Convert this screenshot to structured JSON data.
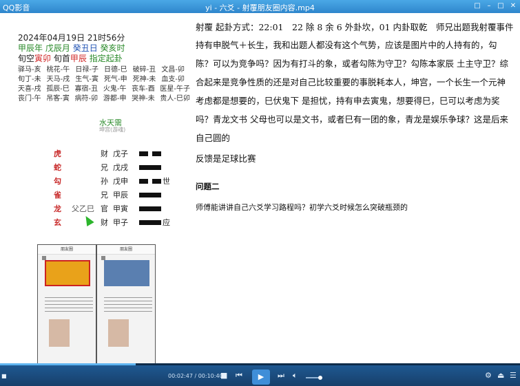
{
  "window": {
    "app_name": "QQ影音",
    "file_title": "yi - 六爻 - 射覆朋友圈内容.mp4",
    "buttons": [
      "□",
      "–",
      "□",
      "✕"
    ]
  },
  "chart": {
    "date_line": "2024年04月19日 21时56分",
    "ganzhi": {
      "y": "甲辰年",
      "m": "戊辰月",
      "d": "癸丑日",
      "h": "癸亥时"
    },
    "xunkong": {
      "label1": "旬空",
      "v1": "寅卯",
      "label2": "旬首",
      "v2": "甲辰",
      "label3": "指定起卦"
    },
    "shensha_rows": [
      [
        "驿马-亥",
        "桃花-午",
        "日禄-子",
        "日德-巳",
        "破碎-丑",
        "文昌-卯"
      ],
      [
        "旬丁-未",
        "天马-戌",
        "生气-寅",
        "死气-申",
        "死神-未",
        "血支-卯"
      ],
      [
        "天喜-戌",
        "孤辰-巳",
        "寡宿-丑",
        "火鬼-午",
        "丧车-酉",
        "医星-午子"
      ],
      [
        "丧门-午",
        "吊客-寅",
        "病符-卯",
        "游都-申",
        "哭神-未",
        "贵人-巳卯"
      ]
    ],
    "gua_name": "水天需",
    "gua_sub": "坤宫(游魂)",
    "lines": [
      {
        "beast": "虎",
        "fushen": "",
        "liuqin": "财",
        "ganzhi": "戊子",
        "type": "yin",
        "shiying": ""
      },
      {
        "beast": "蛇",
        "fushen": "",
        "liuqin": "兄",
        "ganzhi": "戊戌",
        "type": "yang",
        "shiying": ""
      },
      {
        "beast": "勾",
        "fushen": "",
        "liuqin": "孙",
        "ganzhi": "戊申",
        "type": "yin",
        "shiying": "世"
      },
      {
        "beast": "雀",
        "fushen": "",
        "liuqin": "兄",
        "ganzhi": "甲辰",
        "type": "yang",
        "shiying": ""
      },
      {
        "beast": "龙",
        "fushen": "父乙巳",
        "liuqin": "官",
        "ganzhi": "甲寅",
        "type": "yang",
        "shiying": ""
      },
      {
        "beast": "玄",
        "fushen": "",
        "liuqin": "财",
        "ganzhi": "甲子",
        "type": "yang",
        "shiying": "应"
      }
    ]
  },
  "phones": [
    {
      "title": "朋友圈"
    },
    {
      "title": "朋友圈"
    }
  ],
  "text": {
    "head": "射覆 起卦方式：22:01　22 除 8 余 6 外卦坎，01 内卦取乾　师兄出题我射覆事件",
    "body": "持有申脱气＋长生，我和出题人都没有这个气势，应该是图片中的人持有的，勾陈？可以为竞争吗？因为有打斗的象，或者勾陈为守卫？勾陈本家辰 土主守卫？综合起来是竞争性质的还是对自己比较重要的事脱耗本人，坤宫，一个长生一个元神考虑都是想要的，巳伏鬼下 是担忧，持有申去寅鬼，想要得巳，巳可以考虑为奖吗？青龙文书 父母也可以是文书，或者巳有一团的象，青龙是娱乐争球？这是后来自己圆的",
    "feedback": "反馈是足球比赛",
    "q2_title": "问题二",
    "q2_body": "师傅能讲讲自己六爻学习路程吗？初学六爻时候怎么突破瓶颈的"
  },
  "player": {
    "time": "00:02:47 / 00:10:40",
    "progress": 0.261,
    "volume": 0.75,
    "icons": [
      "stop-icon",
      "prev-icon",
      "play-icon",
      "next-icon",
      "volume-icon",
      "settings-icon",
      "eject-icon",
      "menu-icon"
    ]
  }
}
